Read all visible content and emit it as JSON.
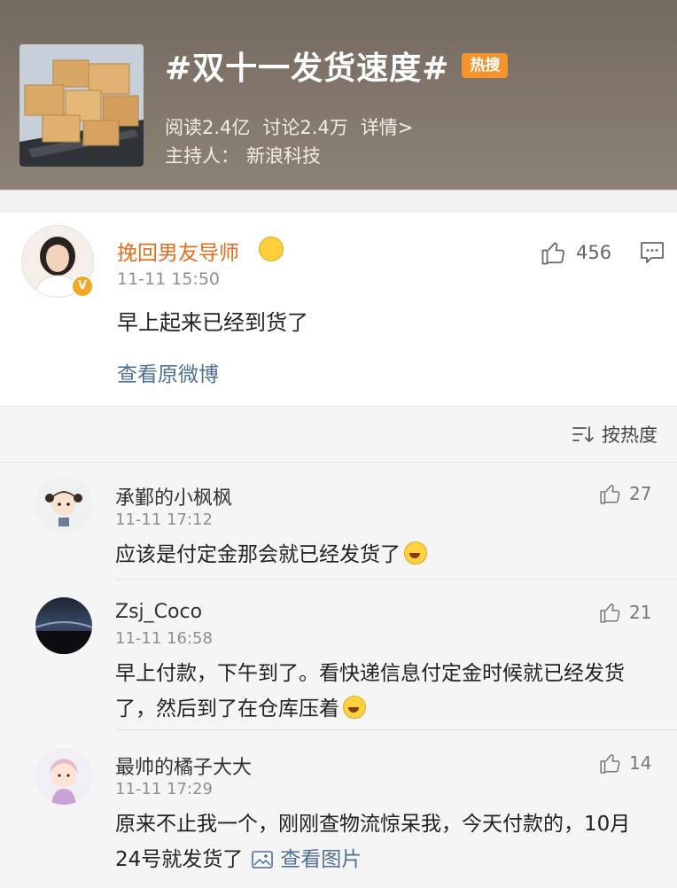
{
  "topic": {
    "title": "#双十一发货速度#",
    "badge": "热搜",
    "reads": "阅读2.4亿",
    "discussions": "讨论2.4万",
    "details": "详情>",
    "host_label": "主持人：",
    "host_name": "新浪科技"
  },
  "post": {
    "author": "挽回男友导师",
    "time": "11-11 15:50",
    "likes": "456",
    "text": "早上起来已经到货了",
    "view_original": "查看原微博"
  },
  "sort": {
    "label": "按热度"
  },
  "comments": [
    {
      "author": "承鄞的小枫枫",
      "time": "11-11 17:12",
      "likes": "27",
      "text": "应该是付定金那会就已经发货了"
    },
    {
      "author": "Zsj_Coco",
      "time": "11-11 16:58",
      "likes": "21",
      "text": "早上付款，下午到了。看快递信息付定金时候就已经发货了，然后到了在仓库压着"
    },
    {
      "author": "最帅的橘子大大",
      "time": "11-11 17:29",
      "likes": "14",
      "text": "原来不止我一个，刚刚查物流惊呆我，今天付款的，10月24号就发货了",
      "view_pic": "查看图片"
    }
  ],
  "colors": {
    "header_bg": "#7f7368",
    "hot_badge": "#f7932c",
    "author_name": "#e86a1b",
    "link": "#4f6f96",
    "comments_bg": "#f5f5f5"
  },
  "icons": [
    "thumbs-up-icon",
    "comment-icon",
    "sort-icon",
    "image-icon",
    "verified-icon",
    "crown-icon",
    "laughing-emoji-icon"
  ]
}
